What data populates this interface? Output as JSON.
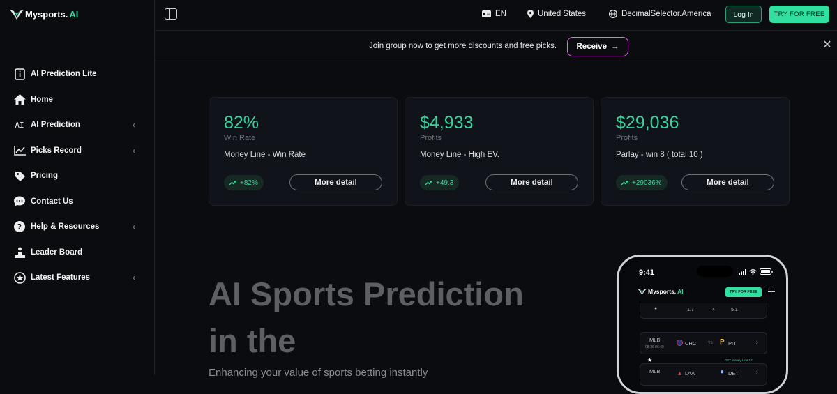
{
  "app": {
    "logo_main": "Mysports.",
    "logo_accent": "AI"
  },
  "sidebar": {
    "items": [
      {
        "label": "AI Prediction Lite",
        "icon": "info-book-icon",
        "has_chevron": false
      },
      {
        "label": "Home",
        "icon": "home-icon",
        "has_chevron": false
      },
      {
        "label": "AI Prediction",
        "icon": "ai-text-icon",
        "has_chevron": true
      },
      {
        "label": "Picks Record",
        "icon": "line-chart-icon",
        "has_chevron": true
      },
      {
        "label": "Pricing",
        "icon": "price-tag-icon",
        "has_chevron": false
      },
      {
        "label": "Contact Us",
        "icon": "chat-bubble-icon",
        "has_chevron": false
      },
      {
        "label": "Help & Resources",
        "icon": "question-circle-icon",
        "has_chevron": true
      },
      {
        "label": "Leader Board",
        "icon": "podium-icon",
        "has_chevron": false
      },
      {
        "label": "Latest Features",
        "icon": "star-circle-icon",
        "has_chevron": true
      }
    ]
  },
  "topbar": {
    "language": "EN",
    "region": "United States",
    "odds_format": "DecimalSelector.America",
    "login_label": "Log In",
    "try_label": "TRY FOR FREE"
  },
  "banner": {
    "text": "Join group now to get more discounts and free picks.",
    "button_label": "Receive"
  },
  "stats": [
    {
      "value": "82%",
      "caption": "Win Rate",
      "desc": "Money Line - Win Rate",
      "change": "+82%",
      "more": "More detail"
    },
    {
      "value": "$4,933",
      "caption": "Profits",
      "desc": "Money Line - High EV.",
      "change": "+49.3",
      "more": "More detail"
    },
    {
      "value": "$29,036",
      "caption": "Profits",
      "desc": "Parlay - win 8 ( total 10 )",
      "change": "+29036%",
      "more": "More detail"
    }
  ],
  "hero": {
    "line1": "AI Sports Prediction",
    "line2": "in the",
    "subtitle": "Enhancing your value of sports betting instantly"
  },
  "phone": {
    "time": "9:41",
    "logo_main": "Mysports.",
    "logo_accent": "AI",
    "try_label": "TRY FOR FREE",
    "row0": {
      "a": "1.7",
      "b": "4",
      "c": "5.1"
    },
    "row1": {
      "league": "MLB",
      "date": "08-26 06:40",
      "home": "CHC",
      "vs": "VS",
      "away": "PIT"
    },
    "row2": {
      "tag": "DET Money Line * 1",
      "league": "MLB",
      "home": "LAA",
      "away": "DET"
    }
  },
  "colors": {
    "accent": "#37d39b",
    "button_green": "#2fe0a0",
    "receive_border": "#e06be2",
    "background": "#0b0c10",
    "card": "#11131a"
  }
}
